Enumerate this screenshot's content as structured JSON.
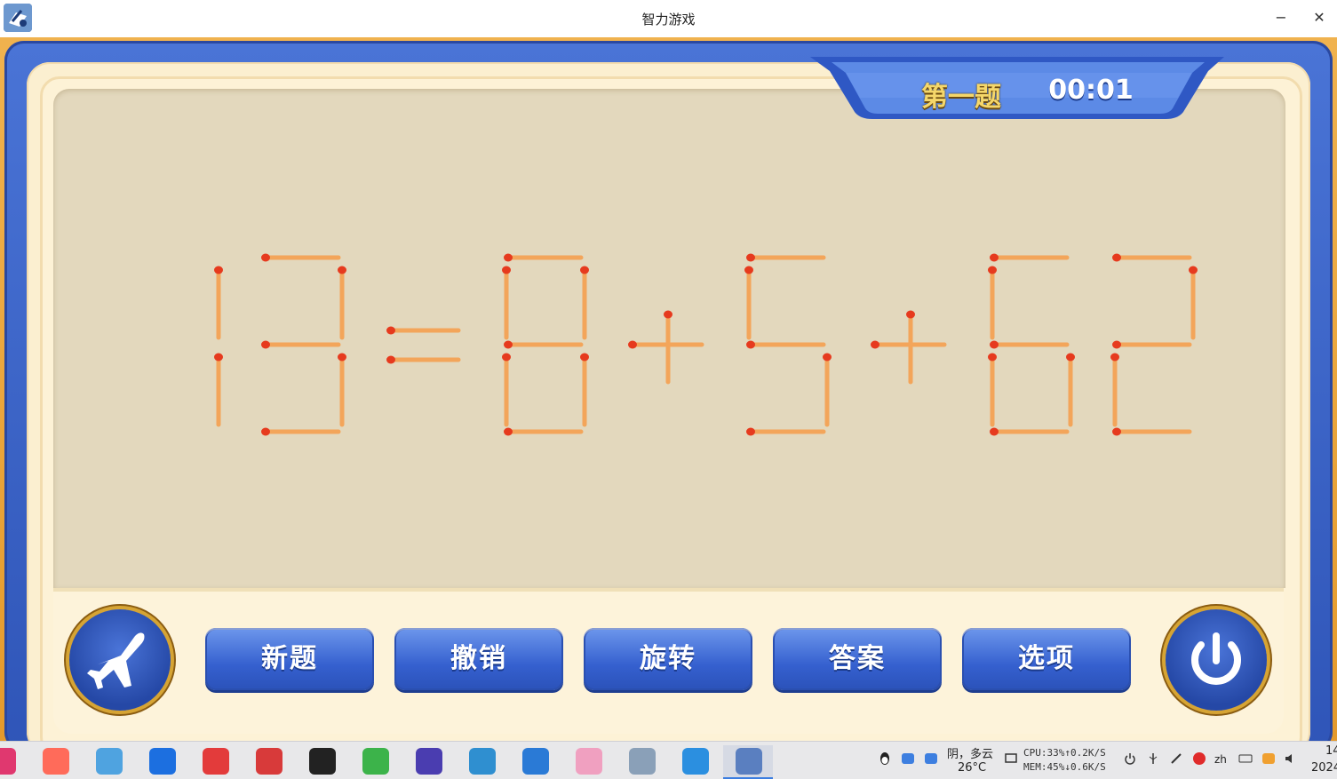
{
  "window": {
    "title": "智力游戏",
    "minimize": "−",
    "close": "✕"
  },
  "header": {
    "level": "第一题",
    "timer": "00:01"
  },
  "puzzle": {
    "equation": "13=8+5+62"
  },
  "controls": {
    "left_round": "plane-icon",
    "buttons": [
      "新题",
      "撤销",
      "旋转",
      "答案",
      "选项"
    ],
    "right_round": "power-icon"
  },
  "colors": {
    "match": "#f3a55a",
    "match_head": "#e63a1e",
    "board": "#e3d8bd",
    "button": "#3560cf",
    "frame": "#3a5fc4"
  },
  "taskbar": {
    "apps": [
      "netease-music-icon",
      "screen-recorder-icon",
      "app-store-icon",
      "feishu-icon",
      "netease-cloud-music-icon",
      "terminal-icon",
      "qq-icon",
      "wechat-icon",
      "cpu-monitor-icon",
      "system-monitor-icon",
      "vscode-icon",
      "image-viewer-icon",
      "package-installer-icon",
      "edge-icon",
      "puzzle-game-icon"
    ],
    "weather_line1": "阴，多云",
    "weather_line2": "26°C",
    "cpu": "CPU:33%↑0.2K/S",
    "mem": "MEM:45%↓0.6K/S",
    "lang": "zh",
    "clock_time": "14",
    "clock_date": "2024"
  }
}
